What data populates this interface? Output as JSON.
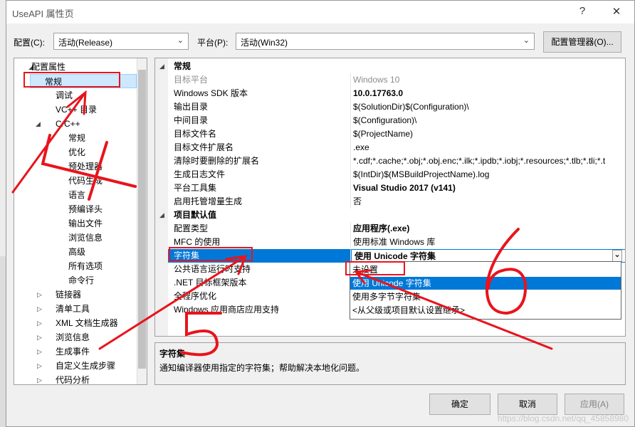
{
  "window": {
    "title": "UseAPI 属性页",
    "help_glyph": "?",
    "close_glyph": "✕"
  },
  "config_bar": {
    "config_label": "配置(C):",
    "config_value": "活动(Release)",
    "platform_label": "平台(P):",
    "platform_value": "活动(Win32)",
    "manager_button": "配置管理器(O)..."
  },
  "tree": {
    "items": [
      {
        "label": "配置属性",
        "expander": "◢"
      },
      {
        "label": "常规"
      },
      {
        "label": "调试"
      },
      {
        "label": "VC++ 目录"
      },
      {
        "label": "C/C++",
        "expander": "◢"
      },
      {
        "label": "常规"
      },
      {
        "label": "优化"
      },
      {
        "label": "预处理器"
      },
      {
        "label": "代码生成"
      },
      {
        "label": "语言"
      },
      {
        "label": "预编译头"
      },
      {
        "label": "输出文件"
      },
      {
        "label": "浏览信息"
      },
      {
        "label": "高级"
      },
      {
        "label": "所有选项"
      },
      {
        "label": "命令行"
      },
      {
        "label": "链接器",
        "expander": "▷"
      },
      {
        "label": "清单工具",
        "expander": "▷"
      },
      {
        "label": "XML 文档生成器",
        "expander": "▷"
      },
      {
        "label": "浏览信息",
        "expander": "▷"
      },
      {
        "label": "生成事件",
        "expander": "▷"
      },
      {
        "label": "自定义生成步骤",
        "expander": "▷"
      },
      {
        "label": "代码分析",
        "expander": "▷"
      }
    ]
  },
  "grid": {
    "rows": [
      {
        "name": "常规",
        "category": true,
        "expander": "◢"
      },
      {
        "name": "目标平台",
        "value": "Windows 10",
        "disabled": true
      },
      {
        "name": "Windows SDK 版本",
        "value": "10.0.17763.0",
        "bold": true
      },
      {
        "name": "输出目录",
        "value": "$(SolutionDir)$(Configuration)\\"
      },
      {
        "name": "中间目录",
        "value": "$(Configuration)\\"
      },
      {
        "name": "目标文件名",
        "value": "$(ProjectName)"
      },
      {
        "name": "目标文件扩展名",
        "value": ".exe"
      },
      {
        "name": "清除时要删除的扩展名",
        "value": "*.cdf;*.cache;*.obj;*.obj.enc;*.ilk;*.ipdb;*.iobj;*.resources;*.tlb;*.tli;*.t"
      },
      {
        "name": "生成日志文件",
        "value": "$(IntDir)$(MSBuildProjectName).log"
      },
      {
        "name": "平台工具集",
        "value": "Visual Studio 2017 (v141)",
        "bold": true
      },
      {
        "name": "启用托管增量生成",
        "value": "否"
      },
      {
        "name": "项目默认值",
        "category": true,
        "expander": "◢"
      },
      {
        "name": "配置类型",
        "value": "应用程序(.exe)",
        "bold": true
      },
      {
        "name": "MFC 的使用",
        "value": "使用标准 Windows 库"
      },
      {
        "name": "字符集",
        "value": "使用 Unicode 字符集",
        "bold": true,
        "selected": true
      },
      {
        "name": "公共语言运行时支持",
        "value": ""
      },
      {
        "name": ".NET 目标框架版本",
        "value": ""
      },
      {
        "name": "全程序优化",
        "value": ""
      },
      {
        "name": "Windows 应用商店应用支持",
        "value": ""
      }
    ],
    "combo_arrow": "⌄"
  },
  "dropdown": {
    "options": [
      "未设置",
      "使用 Unicode 字符集",
      "使用多字节字符集",
      "<从父级或项目默认设置继承>"
    ],
    "highlighted": 1
  },
  "description": {
    "title": "字符集",
    "text": "通知编译器使用指定的字符集；帮助解决本地化问题。"
  },
  "buttons": {
    "ok": "确定",
    "cancel": "取消",
    "apply": "应用(A)"
  },
  "annotations": {
    "marks": [
      "4",
      "5",
      "6"
    ],
    "ink_color": "#e8141c"
  },
  "watermark": "https://blog.csdn.net/qq_45858980"
}
